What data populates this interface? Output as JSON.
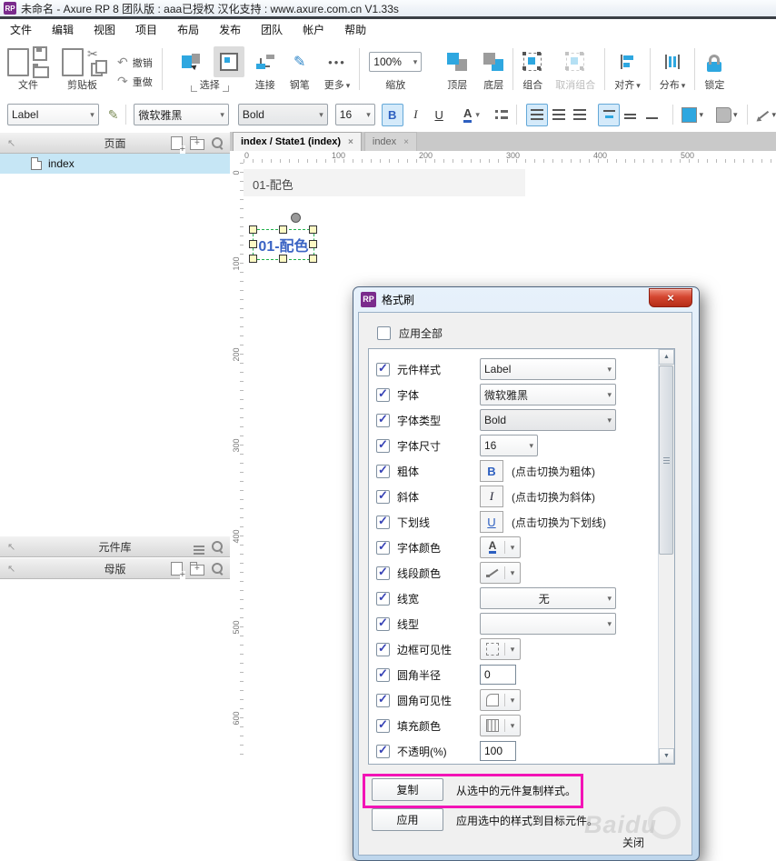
{
  "window": {
    "title": "未命名 - Axure RP 8 团队版 : aaa已授权 汉化支持 : www.axure.com.cn V1.33s",
    "app_icon": "RP"
  },
  "menu": {
    "items": [
      "文件",
      "编辑",
      "视图",
      "项目",
      "布局",
      "发布",
      "团队",
      "帐户",
      "帮助"
    ]
  },
  "toolbar": {
    "file_group": "文件",
    "clipboard_group": "剪贴板",
    "undo": "撤销",
    "redo": "重做",
    "select": "选择",
    "connect": "连接",
    "pen": "钢笔",
    "more": "更多",
    "zoom_value": "100%",
    "zoom_label": "缩放",
    "front": "顶层",
    "back": "底层",
    "group": "组合",
    "ungroup": "取消组合",
    "align": "对齐",
    "distribute": "分布",
    "lock": "锁定"
  },
  "icons": {
    "cut": "✂",
    "undo": "↶",
    "redo": "↷",
    "pen": "✎",
    "more": "•••",
    "dropdown": "▾",
    "up": "▲",
    "down": "▼",
    "close": "×"
  },
  "format_bar": {
    "style": "Label",
    "font": "微软雅黑",
    "weight": "Bold",
    "size": "16",
    "bold": "B",
    "italic": "I",
    "underline": "U",
    "color_letter": "A"
  },
  "sidebar": {
    "pages": {
      "title": "页面",
      "items": [
        {
          "label": "index"
        }
      ]
    },
    "widgets": {
      "title": "元件库"
    },
    "masters": {
      "title": "母版"
    }
  },
  "tabs": [
    {
      "label": "index / State1 (index)",
      "close": "×",
      "active": true
    },
    {
      "label": "index",
      "close": "×",
      "active": false
    }
  ],
  "rulers": {
    "h_numbers": [
      "0",
      "100",
      "200",
      "300",
      "400",
      "500"
    ],
    "v_numbers": [
      "0",
      "100",
      "200",
      "300",
      "400",
      "500",
      "600"
    ]
  },
  "canvas": {
    "band_text": "01-配色",
    "widget_text": "01-配色"
  },
  "dialog": {
    "title": "格式刷",
    "icon": "RP",
    "close": "×",
    "apply_all": "应用全部",
    "rows": [
      {
        "label": "元件样式",
        "type": "combo",
        "value": "Label"
      },
      {
        "label": "字体",
        "type": "combo",
        "value": "微软雅黑"
      },
      {
        "label": "字体类型",
        "type": "combo",
        "value": "Bold",
        "gray": true
      },
      {
        "label": "字体尺寸",
        "type": "combo-small",
        "value": "16"
      },
      {
        "label": "粗体",
        "type": "letter",
        "letter": "B",
        "note": "(点击切换为粗体)"
      },
      {
        "label": "斜体",
        "type": "letter",
        "letter": "I",
        "note": "(点击切换为斜体)"
      },
      {
        "label": "下划线",
        "type": "letter",
        "letter": "U",
        "note": "(点击切换为下划线)"
      },
      {
        "label": "字体颜色",
        "type": "color-a"
      },
      {
        "label": "线段颜色",
        "type": "color-pen"
      },
      {
        "label": "线宽",
        "type": "combo",
        "value": "无",
        "center": true
      },
      {
        "label": "线型",
        "type": "combo-line"
      },
      {
        "label": "边框可见性",
        "type": "drop-border"
      },
      {
        "label": "圆角半径",
        "type": "input",
        "value": "0"
      },
      {
        "label": "圆角可见性",
        "type": "drop-corner"
      },
      {
        "label": "填充颜色",
        "type": "drop-fill"
      },
      {
        "label": "不透明(%)",
        "type": "input",
        "value": "100"
      }
    ],
    "copy_button": "复制",
    "copy_desc": "从选中的元件复制样式。",
    "apply_button": "应用",
    "apply_desc": "应用选中的样式到目标元件。",
    "close_button": "关闭",
    "highlight_color": "#f313b6"
  },
  "watermark": "Baidu",
  "colors": {
    "accent_blue": "#2ea7e0",
    "selection_green": "#21b14b",
    "app_purple": "#7a2b8c"
  }
}
